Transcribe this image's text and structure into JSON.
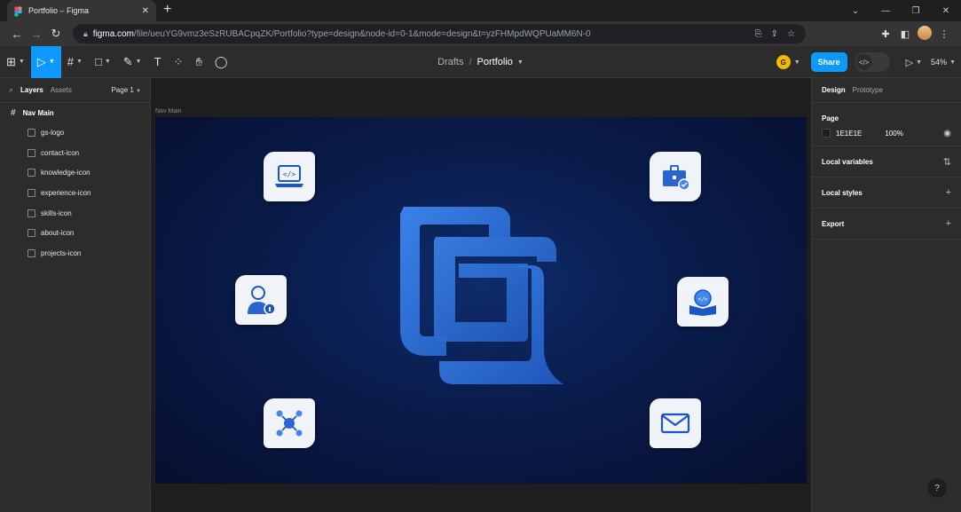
{
  "browser": {
    "tab_title": "Portfolio – Figma",
    "new_tab": "+",
    "url_host": "figma.com",
    "url_path": "/file/ueuYG9vmz3eSzRUBACpqZK/Portfolio?type=design&node-id=0-1&mode=design&t=yzFHMpdWQPUaMM6N-0"
  },
  "toolbar": {
    "text_tool": "T",
    "breadcrumb_parent": "Drafts",
    "breadcrumb_sep": "/",
    "file_name": "Portfolio",
    "user_initial": "G",
    "share_label": "Share",
    "zoom": "54%"
  },
  "left_panel": {
    "tab_layers": "Layers",
    "tab_assets": "Assets",
    "page": "Page 1",
    "frame": "Nav Main",
    "layers": [
      "gs-logo",
      "contact-icon",
      "knowledge-icon",
      "experience-icon",
      "skills-icon",
      "about-icon",
      "projects-icon"
    ]
  },
  "canvas": {
    "frame_label": "Nav Main"
  },
  "right_panel": {
    "tab_design": "Design",
    "tab_prototype": "Prototype",
    "page_heading": "Page",
    "page_color": "1E1E1E",
    "page_opacity": "100%",
    "local_variables": "Local variables",
    "local_styles": "Local styles",
    "export": "Export",
    "help": "?"
  },
  "colors": {
    "accent": "#0d99ff",
    "frame_bg": "#0a1c4c",
    "logo_blue": "#2e6fd8"
  }
}
